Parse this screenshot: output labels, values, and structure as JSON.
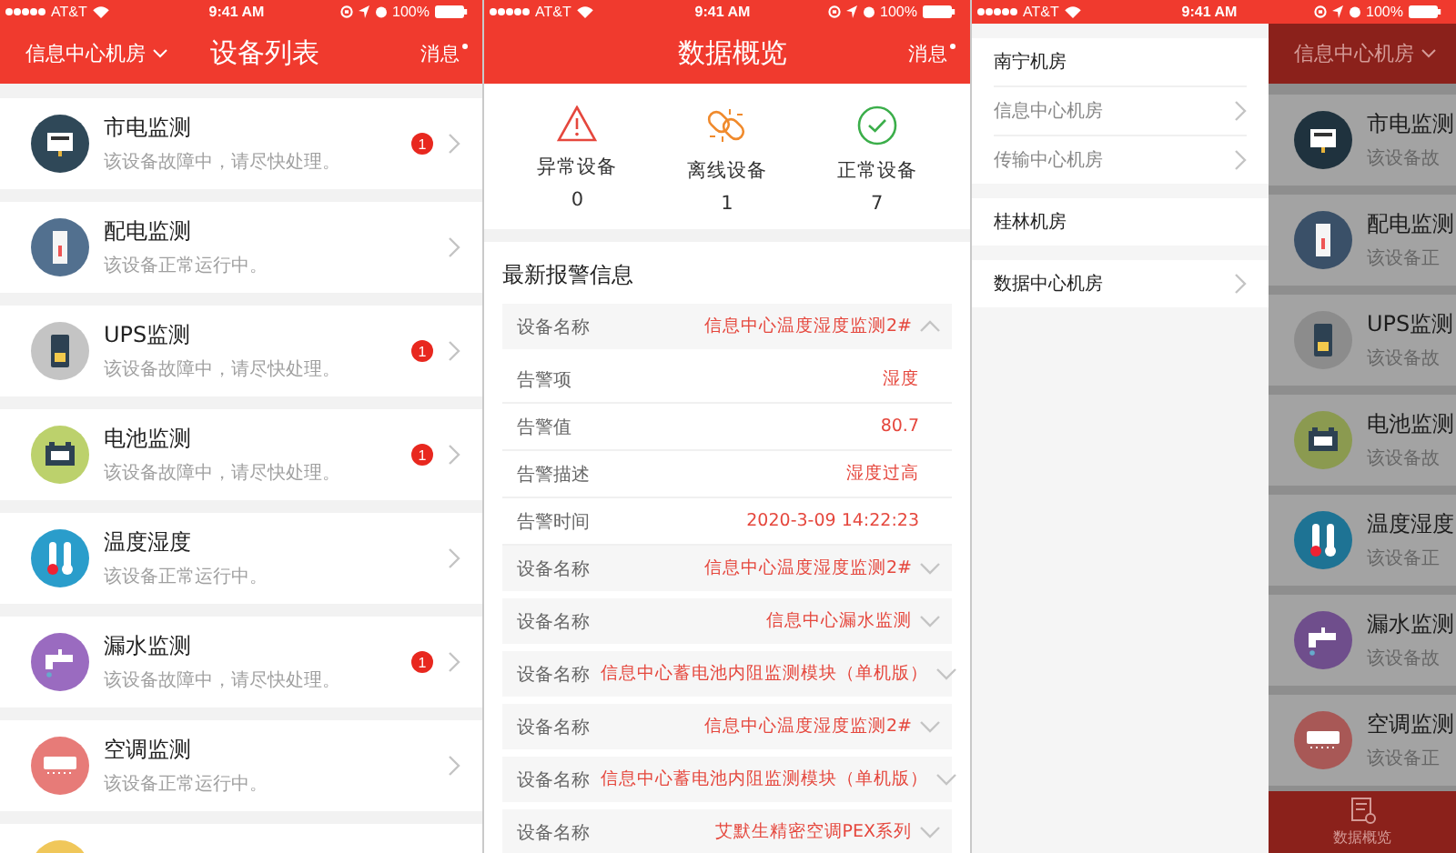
{
  "screens": [
    {
      "kind": "device_list",
      "status_bar": {
        "carrier": "AT&T",
        "time": "9:41 AM",
        "battery": "100%"
      },
      "nav": {
        "location": "信息中心机房",
        "title": "设备列表",
        "messages": "消息",
        "unread": true
      },
      "devices": [
        {
          "kind": "meter",
          "color": "#2f4858",
          "title": "市电监测",
          "subtitle": "该设备故障中，请尽快处理。",
          "alert_count": "1"
        },
        {
          "kind": "panel",
          "color": "#52708f",
          "title": "配电监测",
          "subtitle": "该设备正常运行中。"
        },
        {
          "kind": "ups",
          "color": "#c4c4c4",
          "title": "UPS监测",
          "subtitle": "该设备故障中，请尽快处理。",
          "alert_count": "1"
        },
        {
          "kind": "battery",
          "color": "#bcd16c",
          "title": "电池监测",
          "subtitle": "该设备故障中，请尽快处理。",
          "alert_count": "1"
        },
        {
          "kind": "thermometer",
          "color": "#2a9dcb",
          "title": "温度湿度",
          "subtitle": "该设备正常运行中。"
        },
        {
          "kind": "faucet",
          "color": "#9a6bc0",
          "title": "漏水监测",
          "subtitle": "该设备故障中，请尽快处理。",
          "alert_count": "1"
        },
        {
          "kind": "aircon",
          "color": "#e77b78",
          "title": "空调监测",
          "subtitle": "该设备正常运行中。"
        },
        {
          "kind": "blank",
          "color": "#f0c75a"
        }
      ]
    },
    {
      "kind": "overview",
      "status_bar": {
        "carrier": "AT&T",
        "time": "9:41 AM",
        "battery": "100%"
      },
      "nav": {
        "title": "数据概览",
        "messages": "消息",
        "unread": true
      },
      "stats": [
        {
          "kind": "abnormal",
          "label": "异常设备",
          "count": "0"
        },
        {
          "kind": "offline",
          "label": "离线设备",
          "count": "1"
        },
        {
          "kind": "normal",
          "label": "正常设备",
          "count": "7"
        }
      ],
      "alerts": {
        "heading": "最新报警信息",
        "items": [
          {
            "label": "设备名称",
            "value": "信息中心温度湿度监测2#",
            "expanded": true,
            "details": [
              {
                "label": "告警项",
                "value": "湿度"
              },
              {
                "label": "告警值",
                "value": "80.7"
              },
              {
                "label": "告警描述",
                "value": "湿度过高"
              },
              {
                "label": "告警时间",
                "value": "2020-3-09 14:22:23"
              }
            ]
          },
          {
            "label": "设备名称",
            "value": "信息中心温度湿度监测2#",
            "expanded": false
          },
          {
            "label": "设备名称",
            "value": "信息中心漏水监测",
            "expanded": false
          },
          {
            "label": "设备名称",
            "value": "信息中心蓄电池内阻监测模块（单机版）",
            "expanded": false
          },
          {
            "label": "设备名称",
            "value": "信息中心温度湿度监测2#",
            "expanded": false
          },
          {
            "label": "设备名称",
            "value": "信息中心蓄电池内阻监测模块（单机版）",
            "expanded": false
          },
          {
            "label": "设备名称",
            "value": "艾默生精密空调PEX系列",
            "expanded": false
          }
        ]
      }
    },
    {
      "kind": "drawer",
      "status_bar": {
        "carrier": "AT&T",
        "time": "9:41 AM",
        "battery": "100%"
      },
      "drawer": {
        "groups": [
          {
            "label": "南宁机房",
            "has_arrow": false,
            "children": [
              {
                "label": "信息中心机房",
                "has_arrow": true
              },
              {
                "label": "传输中心机房",
                "has_arrow": true
              }
            ]
          },
          {
            "label": "桂林机房",
            "has_arrow": false
          },
          {
            "label": "数据中心机房",
            "has_arrow": true
          }
        ]
      },
      "background": {
        "location": "信息中心机房",
        "devices": [
          {
            "kind": "meter",
            "color": "#1f323e",
            "title": "市电监测",
            "subtitle": "该设备故"
          },
          {
            "kind": "panel",
            "color": "#3a5068",
            "title": "配电监测",
            "subtitle": "该设备正"
          },
          {
            "kind": "ups",
            "color": "#8c8c8c",
            "title": "UPS监测",
            "subtitle": "该设备故"
          },
          {
            "kind": "battery",
            "color": "#8b9a50",
            "title": "电池监测",
            "subtitle": "该设备故"
          },
          {
            "kind": "thermometer",
            "color": "#1e7394",
            "title": "温度湿度",
            "subtitle": "该设备正"
          },
          {
            "kind": "faucet",
            "color": "#6f4e8c",
            "title": "漏水监测",
            "subtitle": "该设备故"
          },
          {
            "kind": "aircon",
            "color": "#a85856",
            "title": "空调监测",
            "subtitle": "该设备正"
          }
        ],
        "tab_bar": {
          "label": "数据概览"
        }
      }
    }
  ]
}
